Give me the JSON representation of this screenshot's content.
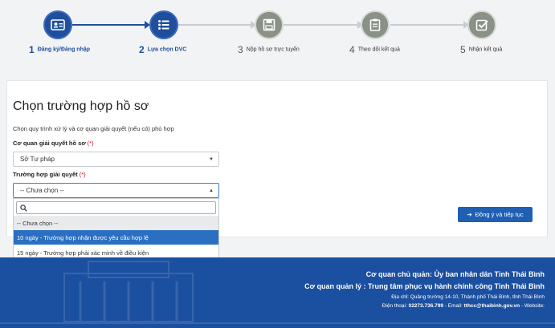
{
  "stepper": {
    "steps": [
      {
        "num": "1",
        "label": "Đăng ký/Đăng nhập",
        "icon": "id-card-icon",
        "state": "done"
      },
      {
        "num": "2",
        "label": "Lựa chọn DVC",
        "icon": "list-icon",
        "state": "active"
      },
      {
        "num": "3",
        "label": "Nộp hồ sơ trực tuyến",
        "icon": "floppy-disk-icon",
        "state": "pending"
      },
      {
        "num": "4",
        "label": "Theo dõi kết quả",
        "icon": "clipboard-icon",
        "state": "pending"
      },
      {
        "num": "5",
        "label": "Nhận kết quả",
        "icon": "checkbox-icon",
        "state": "pending"
      }
    ]
  },
  "main": {
    "title": "Chọn trường hợp hồ sơ",
    "subtitle": "Chọn quy trình xử lý và cơ quan giải quyết (nếu có) phù hợp",
    "agency": {
      "label": "Cơ quan giải quyết hồ sơ",
      "required_mark": "(*)",
      "selected": "Sở Tư pháp"
    },
    "case": {
      "label": "Trường hợp giải quyết",
      "required_mark": "(*)",
      "selected": "-- Chưa chọn --",
      "options": [
        "-- Chưa chọn --",
        "10 ngày - Trường hợp nhận được yêu cầu hợp lệ",
        "15 ngày - Trường hợp phải xác minh về điều kiện"
      ]
    },
    "next_button": "Đồng ý và tiếp tục"
  },
  "footer": {
    "line1": "Cơ quan chủ quản: Ủy ban nhân dân Tỉnh Thái Bình",
    "line2": "Cơ quan quản lý : Trung tâm phục vụ hành chính công Tỉnh Thái Bình",
    "address": "Địa chỉ: Quảng trường 14-10, Thành phố Thái Bình, tỉnh Thái Bình",
    "phone_prefix": "Điện thoại: ",
    "phone": "02273.736.799",
    "email_prefix": " - Email: ",
    "email": "tthcc@thaibinh.gov.vn",
    "website_prefix": " - Website:"
  },
  "colors": {
    "primary": "#1f4e9c",
    "step_pending": "#8a9186",
    "highlight": "#2a6fc1",
    "footer_bg": "#1b4fa0",
    "required": "#d0021b"
  }
}
